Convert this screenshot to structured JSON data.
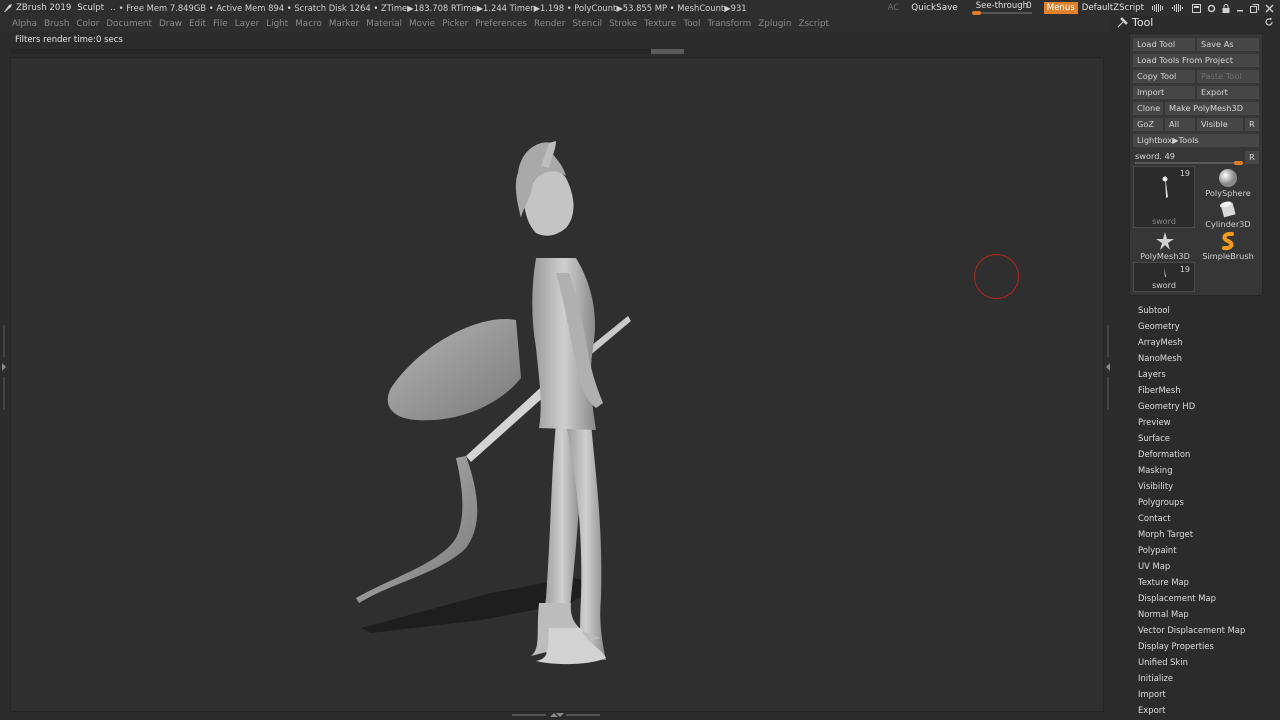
{
  "titlebar": {
    "app_title": "ZBrush 2019",
    "mode": "Sculpt",
    "dots": "..",
    "stats": "• Free Mem 7.849GB • Active Mem 894 • Scratch Disk 1264 • ZTime▶183.708 RTime▶1.244 Timer▶1.198 • PolyCount▶53.855 MP  • MeshCount▶931",
    "ac_label": "AC",
    "quicksave_label": "QuickSave",
    "see_through_label": "See-through",
    "see_through_value": "0",
    "see_through_level": 0,
    "menus_label": "Menus",
    "default_script_label": "DefaultZScript"
  },
  "menubar": {
    "items": [
      "Alpha",
      "Brush",
      "Color",
      "Document",
      "Draw",
      "Edit",
      "File",
      "Layer",
      "Light",
      "Macro",
      "Marker",
      "Material",
      "Movie",
      "Picker",
      "Preferences",
      "Render",
      "Stencil",
      "Stroke",
      "Texture",
      "Tool",
      "Transform",
      "Zplugin",
      "Zscript"
    ]
  },
  "info": {
    "message": "Filters render time:0 secs"
  },
  "tool_panel": {
    "title": "Tool",
    "load_tool": "Load Tool",
    "save_as": "Save As",
    "load_from_project": "Load Tools From Project",
    "copy_tool": "Copy Tool",
    "paste_tool": "Paste Tool",
    "import": "Import",
    "export": "Export",
    "clone": "Clone",
    "make_polymesh": "Make PolyMesh3D",
    "goz": "GoZ",
    "all": "All",
    "visible": "Visible",
    "r_label": "R",
    "lightbox_tools": "Lightbox▶Tools",
    "current_tool_label": "sword. 49",
    "current_tool_level": 1.0,
    "thumbs": {
      "main_name": "sword",
      "main_count": "19",
      "polysphere": "PolySphere",
      "cylinder": "Cylinder3D",
      "polymesh": "PolyMesh3D",
      "simplebrush": "SimpleBrush",
      "small_name": "sword",
      "small_count": "19"
    },
    "subpalettes": [
      "Subtool",
      "Geometry",
      "ArrayMesh",
      "NanoMesh",
      "Layers",
      "FiberMesh",
      "Geometry HD",
      "Preview",
      "Surface",
      "Deformation",
      "Masking",
      "Visibility",
      "Polygroups",
      "Contact",
      "Morph Target",
      "Polypaint",
      "UV Map",
      "Texture Map",
      "Displacement Map",
      "Normal Map",
      "Vector Displacement Map",
      "Display Properties",
      "Unified Skin",
      "Initialize",
      "Import",
      "Export"
    ]
  },
  "colors": {
    "accent": "#e07b27",
    "brush_cursor": "#b0281f",
    "canvas": "#2f2f2f"
  }
}
